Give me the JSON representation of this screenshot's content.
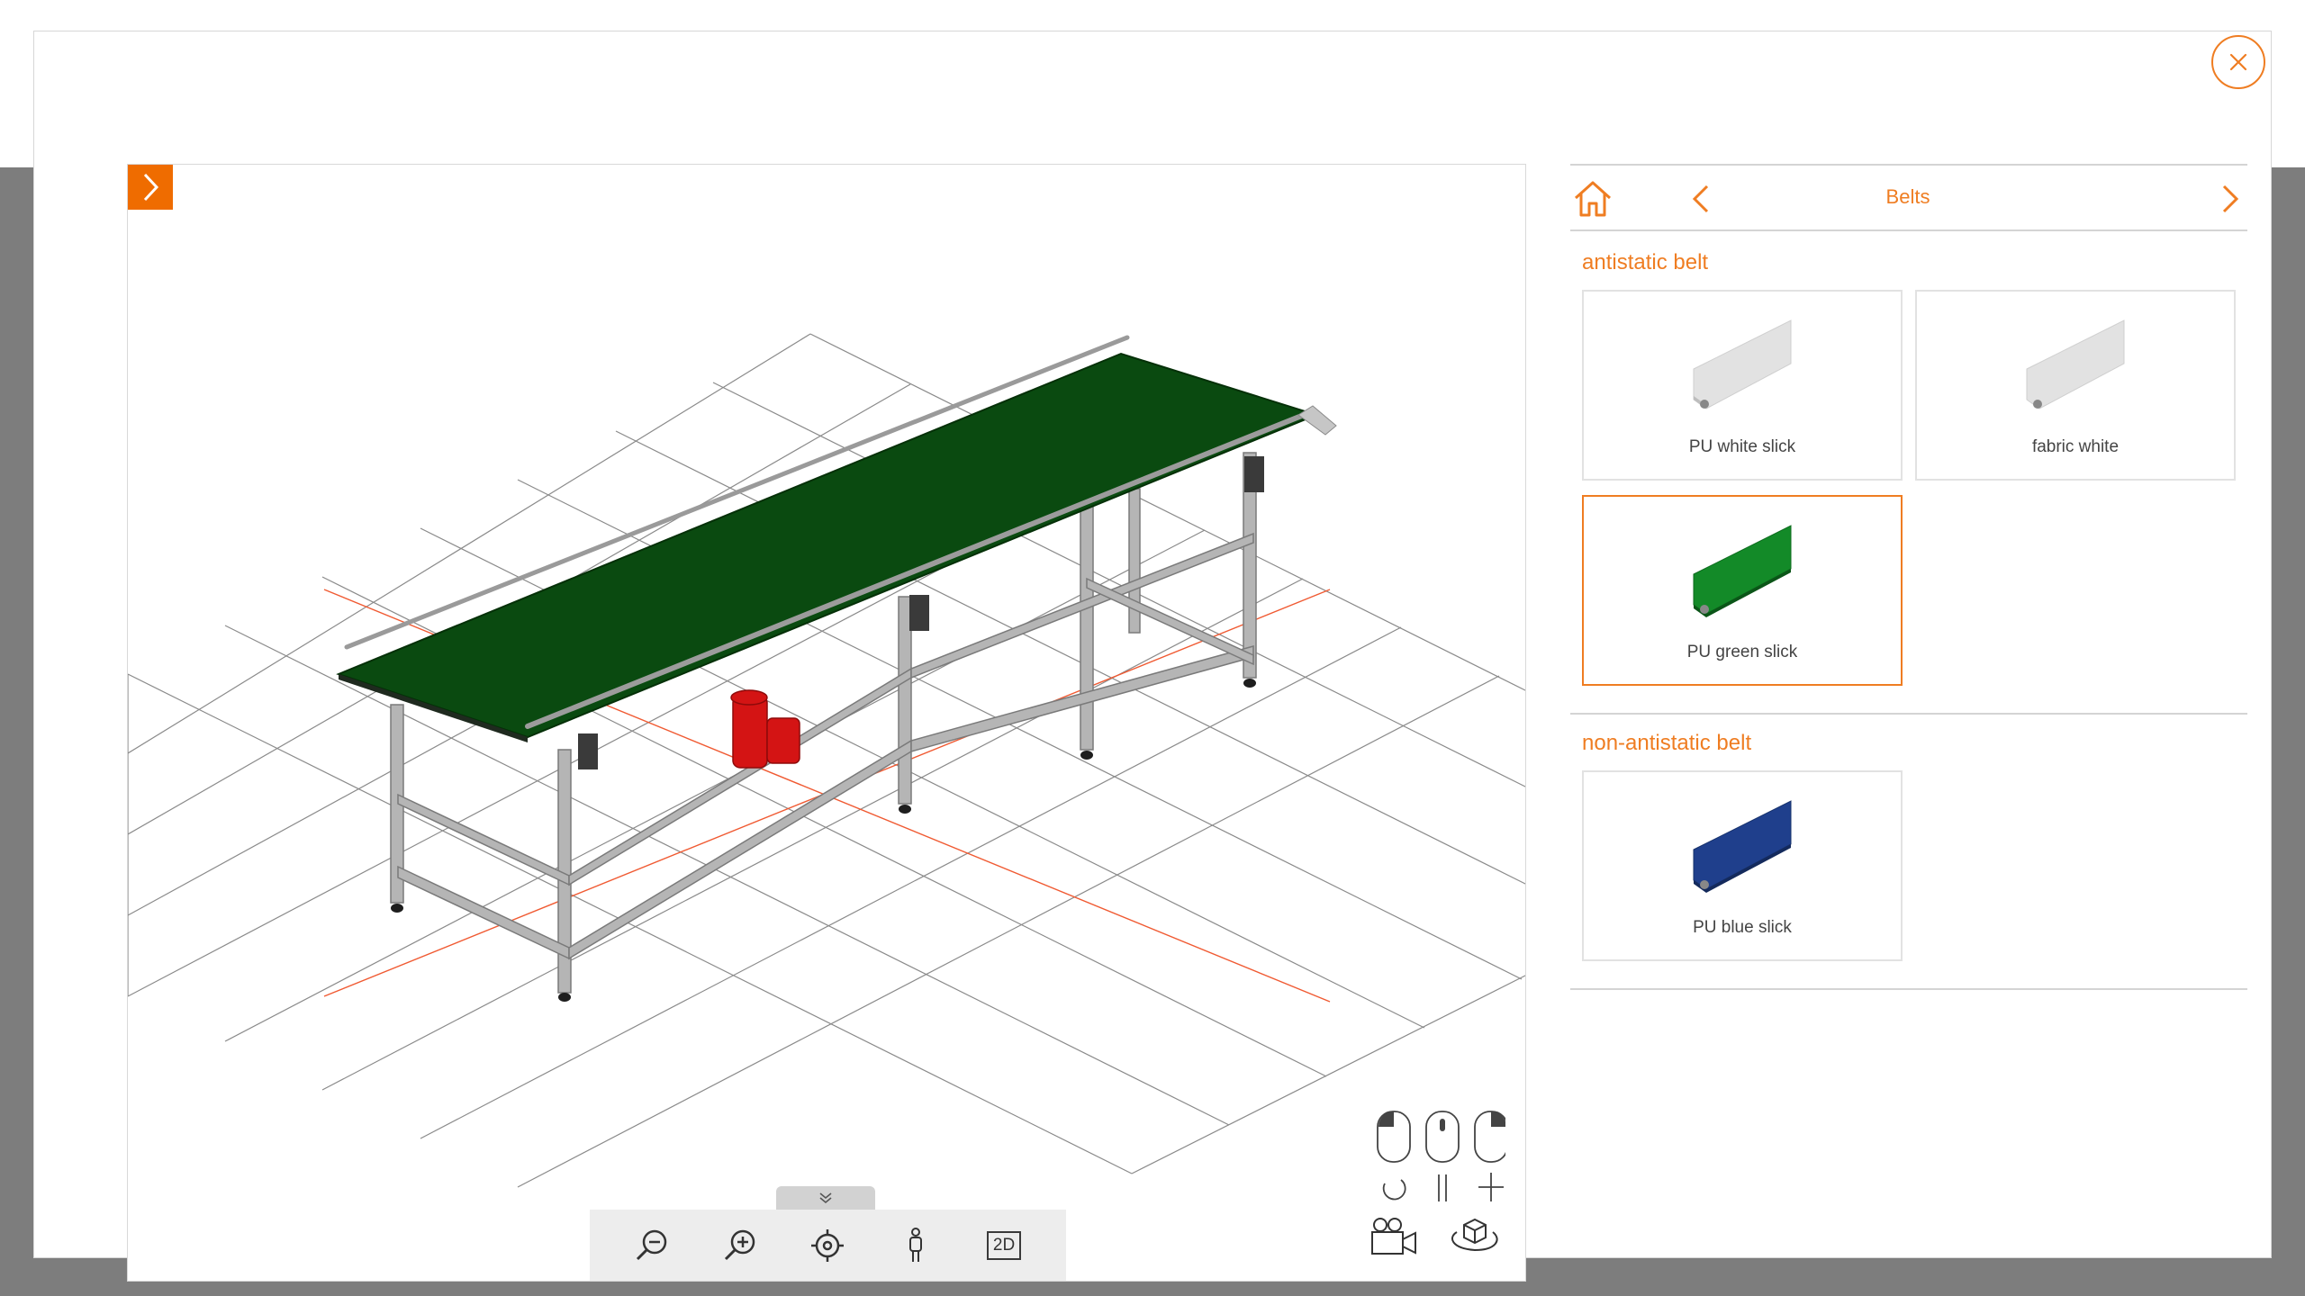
{
  "window": {
    "close_icon": "close-icon"
  },
  "viewer": {
    "expand_icon": "chevron-right-icon",
    "toolbar": {
      "zoom_out_icon": "zoom-out-icon",
      "zoom_in_icon": "zoom-in-icon",
      "center_icon": "target-icon",
      "person_icon": "person-icon",
      "view_2d_label": "2D"
    },
    "drawer_icon": "double-chevron-down-icon",
    "camera_icon": "video-camera-icon",
    "rotate_view_icon": "rotate-cube-icon"
  },
  "panel": {
    "nav": {
      "title": "Belts",
      "home_icon": "home-icon",
      "prev_icon": "chevron-left-icon",
      "next_icon": "chevron-right-icon"
    },
    "sections": [
      {
        "title": "antistatic belt",
        "items": [
          {
            "label": "PU white slick",
            "color": "#e2e2e2",
            "selected": false
          },
          {
            "label": "fabric white",
            "color": "#e2e2e2",
            "selected": false
          },
          {
            "label": "PU green slick",
            "color": "#138a28",
            "selected": true
          }
        ]
      },
      {
        "title": "non-antistatic belt",
        "items": [
          {
            "label": "PU blue slick",
            "color": "#1f3f8c",
            "selected": false
          }
        ]
      }
    ]
  },
  "colors": {
    "accent": "#ef7d22",
    "belt": "#0a4a10",
    "motor": "#d41414",
    "frame": "#a8a8a8"
  }
}
